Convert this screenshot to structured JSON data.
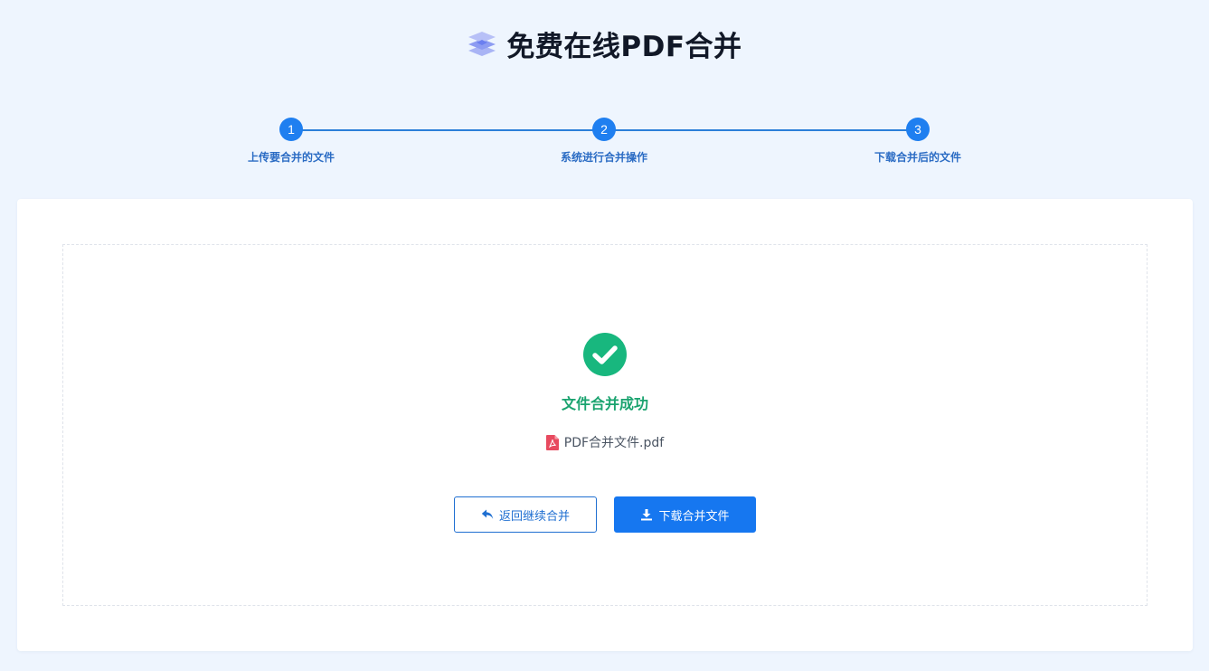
{
  "header": {
    "title": "免费在线PDF合并",
    "logo_icon": "layers-icon"
  },
  "steps": [
    {
      "number": "1",
      "label": "上传要合并的文件"
    },
    {
      "number": "2",
      "label": "系统进行合并操作"
    },
    {
      "number": "3",
      "label": "下载合并后的文件"
    }
  ],
  "result": {
    "status_icon": "check-circle-icon",
    "status_text": "文件合并成功",
    "file_icon": "pdf-file-icon",
    "file_name": "PDF合并文件.pdf"
  },
  "actions": {
    "back_label": "返回继续合并",
    "back_icon": "reply-arrow-icon",
    "download_label": "下载合并文件",
    "download_icon": "download-icon"
  },
  "colors": {
    "background": "#eef5fe",
    "accent": "#1677f0",
    "success": "#1aa36f",
    "pdf_red": "#e84a5f"
  }
}
